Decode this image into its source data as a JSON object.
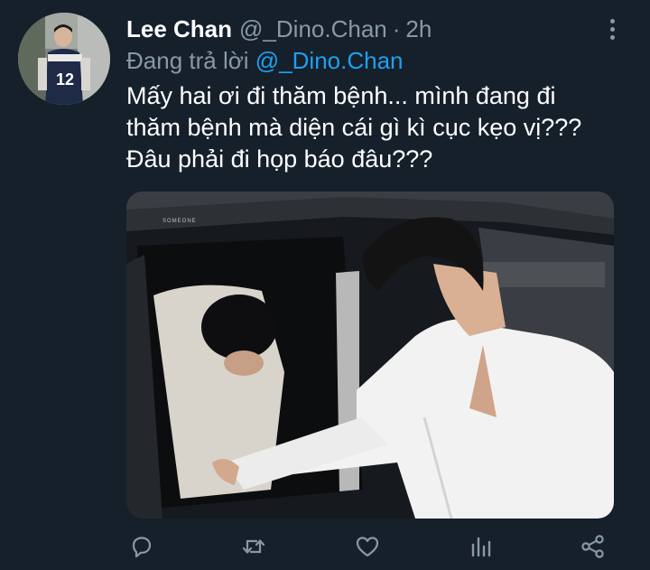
{
  "tweet": {
    "author": {
      "display_name": "Lee Chan",
      "handle": "@_Dino.Chan",
      "separator": "·",
      "time": "2h"
    },
    "reply": {
      "prefix": "Đang trả lời",
      "mention": "@_Dino.Chan"
    },
    "text_lines": [
      "Mấy hai ơi đi thăm bệnh... mình đang đi",
      "thăm bệnh mà diện cái gì kì cục kẹo vị???",
      "Đâu phải đi họp báo đâu???"
    ],
    "media": {
      "watermark": "SOMEONE"
    },
    "icons": {
      "more": "more-vertical-icon",
      "reply": "reply-icon",
      "retweet": "retweet-icon",
      "like": "heart-icon",
      "analytics": "analytics-icon",
      "share": "share-icon"
    },
    "colors": {
      "background": "#15202b",
      "secondary_text": "#8899a6",
      "accent": "#1da1f2",
      "primary_text": "#ffffff"
    }
  }
}
